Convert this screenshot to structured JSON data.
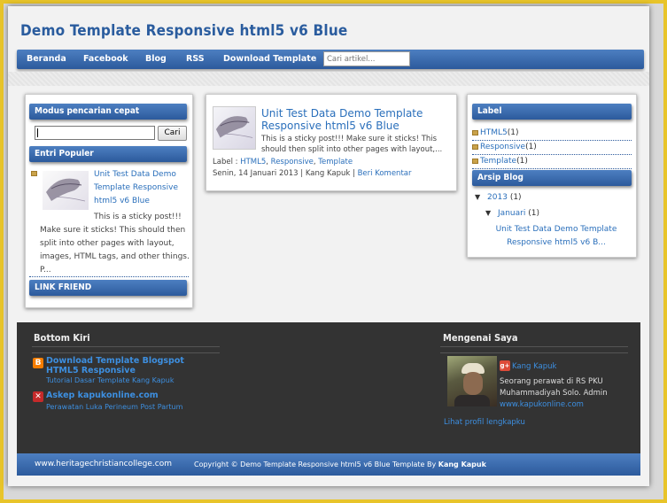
{
  "site": {
    "title": "Demo Template Responsive html5 v6 Blue"
  },
  "nav": {
    "items": [
      "Beranda",
      "Facebook",
      "Blog",
      "RSS",
      "Download Template"
    ],
    "search_placeholder": "Cari artikel..."
  },
  "left": {
    "search_heading": "Modus pencarian cepat",
    "search_button": "Cari",
    "popular_heading": "Entri Populer",
    "popular_title": "Unit Test Data Demo Template Responsive html5 v6 Blue",
    "popular_snippet": "This is a sticky post!!! Make sure it sticks! This should then split into other pages with layout, images, HTML tags, and other things. P...",
    "link_heading": "LINK FRIEND"
  },
  "post": {
    "title": "Unit Test Data Demo Template Responsive html5 v6 Blue",
    "snippet": "This is a sticky post!!! Make sure it sticks! This should then split into other pages with layout,...",
    "label_prefix": "Label :",
    "labels": [
      "HTML5",
      "Responsive",
      "Template"
    ],
    "date_author": "Senin, 14 Januari 2013 | Kang Kapuk |",
    "comment_link": "Beri Komentar"
  },
  "right": {
    "label_heading": "Label",
    "labels": [
      {
        "name": "HTML5",
        "count": "(1)"
      },
      {
        "name": "Responsive",
        "count": "(1)"
      },
      {
        "name": "Template",
        "count": "(1)"
      }
    ],
    "archive_heading": "Arsip Blog",
    "year": "2013",
    "year_count": "(1)",
    "month": "Januari",
    "month_count": "(1)",
    "archive_post": "Unit Test Data Demo Template Responsive html5 v6 B..."
  },
  "bottom": {
    "left_heading": "Bottom Kiri",
    "links": [
      {
        "title": "Download Template Blogspot HTML5 Responsive",
        "sub": "Tutorial Dasar Template Kang Kapuk"
      },
      {
        "title": "Askep kapukonline.com",
        "sub": "Perawatan Luka Perineum Post Partum"
      }
    ],
    "about_heading": "Mengenai Saya",
    "profile_name": "Kang Kapuk",
    "profile_desc": "Seorang perawat di RS PKU Muhammadiyah Solo. Admin",
    "profile_site": "www.kapukonline.com",
    "profile_link": "Lihat profil lengkapku"
  },
  "footer": {
    "site_url": "www.heritagechristiancollege.com",
    "copyright": "Copyright © Demo Template Responsive html5 v6 Blue",
    "template_by": "Template By",
    "author": "Kang Kapuk"
  },
  "colors": {
    "accent": "#2c5a9c",
    "link": "#2a6fbb",
    "frame": "#e8c42a",
    "dark_band": "#333333"
  }
}
